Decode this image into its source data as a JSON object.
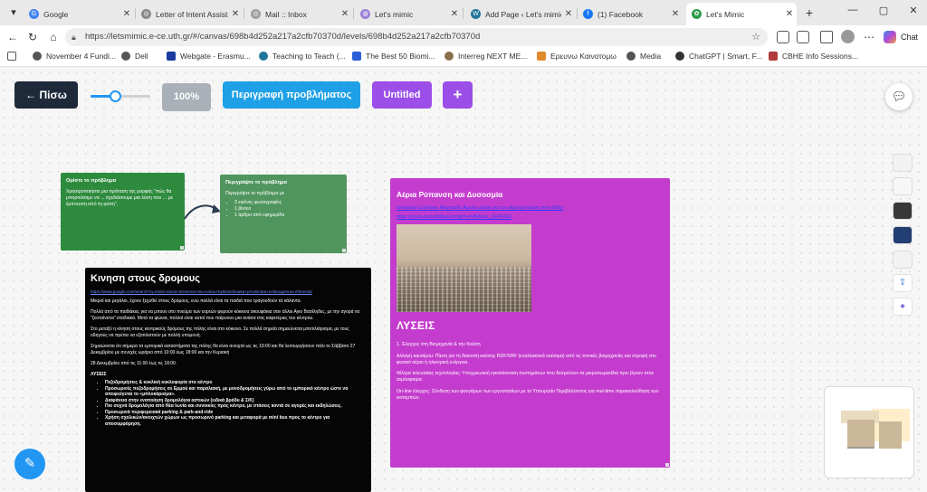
{
  "browser": {
    "tabs": [
      {
        "label": "Google",
        "fav_color": "#4285f4",
        "fav_glyph": "G",
        "active": false
      },
      {
        "label": "Letter of Intent Assista",
        "fav_color": "#888888",
        "fav_glyph": "◎",
        "active": false
      },
      {
        "label": "Mail :: Inbox",
        "fav_color": "#9e9e9e",
        "fav_glyph": "◎",
        "active": false
      },
      {
        "label": "Let's mimic",
        "fav_color": "#9b7fd6",
        "fav_glyph": "◍",
        "active": false
      },
      {
        "label": "Add Page ‹ Let's mimic",
        "fav_color": "#21759b",
        "fav_glyph": "W",
        "active": false
      },
      {
        "label": "(1) Facebook",
        "fav_color": "#1877f2",
        "fav_glyph": "f",
        "active": false
      },
      {
        "label": "Let's Mimic",
        "fav_color": "#2e9b4a",
        "fav_glyph": "✿",
        "active": true
      }
    ],
    "url": "https://letsmimic.e-ce.uth.gr/#/canvas/698b4d252a217a2cfb70370d/levels/698b4d252a217a2cfb70370d",
    "chat_label": "Chat",
    "bookmarks": [
      {
        "label": "November 4 Fundi...",
        "color": "#555555"
      },
      {
        "label": "Dell",
        "color": "#555555"
      },
      {
        "label": "Webgate - Erasmu...",
        "color": "#1a3aa0"
      },
      {
        "label": "Teaching to Teach (...",
        "color": "#21759b"
      },
      {
        "label": "The Best 50 Biomi...",
        "color": "#2a60d8"
      },
      {
        "label": "Interreg NEXT ME...",
        "color": "#8a6f4e"
      },
      {
        "label": "Ερευνω Καινοτομω",
        "color": "#e08a2c"
      },
      {
        "label": "Media",
        "color": "#555555"
      },
      {
        "label": "ChatGPT | Smart, F...",
        "color": "#333333"
      },
      {
        "label": "CBHE Info Sessions...",
        "color": "#b23a3a"
      }
    ]
  },
  "toolbar": {
    "back_label": "← Πίσω",
    "zoom_level": "100%",
    "zoom_fraction": 0.35,
    "description_label": "Περιγραφή προβλήματος",
    "untitled_label": "Untitled",
    "plus_label": "+"
  },
  "cards": {
    "define": {
      "title": "Ορίστε το πρόβλημα",
      "body": "Χρησιμοποιήστε μια πρόταση της μορφής \"πώς θα μπορούσαμε να ... σχεδιάσουμε μια λύση που ... με έμπνευση από τη φύση\"."
    },
    "describe": {
      "title": "Περιγράψτε το πρόβλημα",
      "intro": "Περιγράψτε το πρόβλημα με",
      "items": [
        "3 εικόνες φωτογραφίες",
        "1 βίντεο",
        "1 άρθρο από εφημερίδα"
      ]
    },
    "traffic": {
      "title": "Κινηση στους δρομους",
      "link": "https://www.google.com/search?q=kinisi+stous+dromous+tou+volou+kyklosoforiaka+provlimata+xristougenna+efimerida",
      "paragraphs": [
        "Μικροί και μεγάλοι, έχουν ξεχυθεί στους δρόμους, ενώ πολλά είναι τα παιδιά που τραγουδούν τα κάλαντα.",
        "Πολλά από τα παιδιάκια, για να μπουν στο πνεύμα των εορτών φορούν κόκκινα σκουφάκια σαν άλλοι Αγιο Βασίληδες, με την αγορά να \"ζεσταίνεται\" σταδιακά. Μετά τα ψώνια, πολλοί είναι αυτοί που παίρνουν μια ανάσα στις καφετέριες του κέντρου.",
        "Στο μεταξύ η κίνηση στους κεντρικούς δρόμους της πόλης είναι στο κόκκινο. Σε πολλά σημεία σημειώνεται μποτιλιάρισμα, με τους οδηγούς να πρέπει να εξοπλιστούν με πολλή υπομονή.",
        "Σημειώνεται ότι σήμερα τα εμπορικά καταστήματα της πόλης θα είναι ανοιχτά ως τις 19:00 και θα λειτουργήσουν πάλι το Σάββατο 27 Δεκεμβρίου με συνεχές ωράριο από 10:00 έως 18:00 και την Κυριακή",
        "28 Δεκεμβρίου από τις 11:00 έως τις 18:00."
      ],
      "solutions_heading": "ΛΥΣΕΙΣ",
      "solutions": [
        "Πεζοδρομήσεις & κυκλική κυκλοφορία στο κέντρο",
        "Προσωρινές πεζοδρομήσεις σε Ερμού και παραλιακή, με μονοδρομήσεις γύρω από το εμπορικό κέντρο ώστε να αποφεύγεται το «μπλοκάρισμα».",
        "Διαφάνεια στην ενοποίηση δρομολόγια αστικών (ειδικά βράδυ & Σ/Κ)",
        "Πιο συχνά δρομολόγια από Νέα Ιωνία και συνοικίες προς κέντρο, με στάσεις κοντά σε αγορές και εκδηλώσεις.",
        "Προσωρινά περιφερειακά parking & park-and-ride",
        "Χρήση σχολικών/ανοιχτών χώρων ως προσωρινό parking και μεταφορά με mini bus προς το κέντρο για αποσυμφόρηση."
      ]
    },
    "pollution": {
      "title": "Αέρια Ρύπανση και Δυσοσμία",
      "link1": "Ιστολόγιο Συλλόγου Μαγνησία: Άμεσα μέτρα για την αέρια ρύπανση στον Βόλο",
      "link2": "https://youtu.be/xsDdbuGmmtg?si=efEfUez_OaFF002",
      "solutions_heading": "ΛΥΣΕΙΣ",
      "paragraphs": [
        "1. Έλεγχος στη Βιομηχανία & την Καύση",
        "Αλλαγή καυσίμου: Πίεση για τη διακοπή καύσης RDF/SRF (εναλλακτικά καύσιμα) από τις τοπικές βιομηχανίες και στροφή στο φυσικό αέριο ή ηλεκτρική ενέργεια.",
        "Φίλτρα τελευταίας τεχνολογίας: Υποχρεωτική εγκατάσταση συστημάτων που δεσμεύουν τα μικροσωματίδια πριν βγουν στην ατμόσφαιρα.",
        "On-line έλεγχος: Σύνδεση των φουγάρων των εργοστασίων με το Υπουργείο Περιβάλλοντος για real-time παρακολούθηση των εκπομπών."
      ]
    }
  },
  "side_swatches": [
    "#f2f2f2",
    "#f7f7f7",
    "#383838",
    "#233e73",
    "#f2f2f2"
  ],
  "minimap_colors": [
    "#e9dcc0",
    "#cbb89a",
    "#ffeec9",
    "#a09c96"
  ],
  "colors": {
    "back_button": "#1e2a3a",
    "description_button": "#1ea0e6",
    "untitled_button": "#9b4ee8",
    "zoom_button": "#a9b0b8",
    "card_green_1": "#2e8b3e",
    "card_green_2": "#51955e",
    "card_black": "#050505",
    "card_purple": "#c43ccd",
    "accent": "#2196f3"
  }
}
